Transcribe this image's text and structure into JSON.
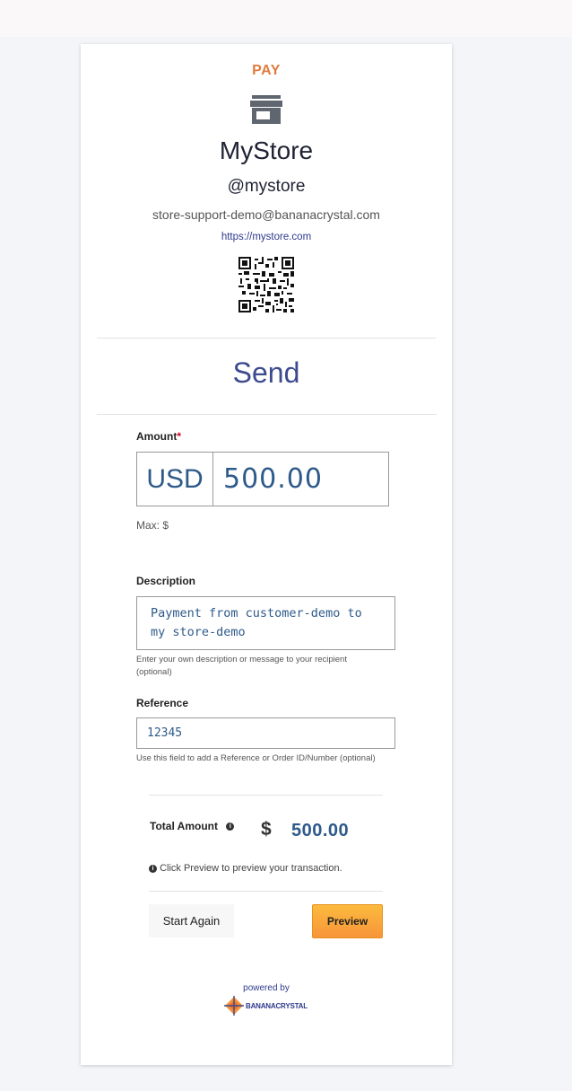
{
  "header": {
    "pay_label": "PAY"
  },
  "store": {
    "name": "MyStore",
    "handle": "@mystore",
    "email": "store-support-demo@bananacrystal.com",
    "url": "https://mystore.com",
    "icon": "store-icon",
    "qr_icon": "qr-code-icon"
  },
  "title": "Send",
  "amount": {
    "label": "Amount",
    "required_mark": "*",
    "currency": "USD",
    "value": "500.00",
    "max_label": "Max: $"
  },
  "description": {
    "label": "Description",
    "value": "Payment from customer-demo to my store-demo",
    "hint": "Enter your own description or message to your recipient (optional)"
  },
  "reference": {
    "label": "Reference",
    "value": "12345",
    "hint": "Use this field to add a Reference or Order ID/Number (optional)"
  },
  "total": {
    "label": "Total Amount",
    "info_icon": "info-icon",
    "currency_symbol": "$",
    "value": "500.00"
  },
  "note": "Click Preview to preview your transaction.",
  "buttons": {
    "start_again": "Start Again",
    "preview": "Preview"
  },
  "footer": {
    "powered_by": "powered by",
    "brand": "BANANACRYSTAL",
    "logo_icon": "bananacrystal-logo-icon"
  },
  "colors": {
    "accent_orange": "#e07c3e",
    "title_blue": "#3d4a8f",
    "value_blue": "#2e5a8a",
    "button_orange": "#f7943a"
  }
}
